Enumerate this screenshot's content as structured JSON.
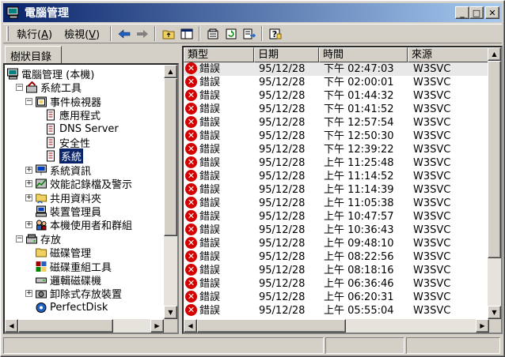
{
  "window": {
    "title": "電腦管理",
    "buttons": {
      "minimize": "_",
      "maximize": "□",
      "close": "✕"
    }
  },
  "menu": [
    {
      "label": "執行(",
      "accel": "A",
      "suffix": ")"
    },
    {
      "label": "檢視(",
      "accel": "V",
      "suffix": ")"
    }
  ],
  "toolbar_icons": [
    "back-arrow-icon",
    "forward-arrow-icon",
    "up-folder-icon",
    "show-hide-tree-icon",
    "properties-icon",
    "refresh-icon",
    "export-list-icon",
    "help-icon"
  ],
  "left_tab": "樹狀目錄",
  "tree": [
    {
      "label": "電腦管理 (本機)",
      "indent": 0,
      "expander": "",
      "icon": "computer-management-icon",
      "name": "tree-computer-management"
    },
    {
      "label": "系統工具",
      "indent": 1,
      "expander": "−",
      "icon": "system-tools-icon",
      "name": "tree-system-tools"
    },
    {
      "label": "事件檢視器",
      "indent": 2,
      "expander": "−",
      "icon": "event-viewer-icon",
      "name": "tree-event-viewer"
    },
    {
      "label": "應用程式",
      "indent": 3,
      "expander": "",
      "icon": "log-icon",
      "name": "tree-application-log"
    },
    {
      "label": "DNS Server",
      "indent": 3,
      "expander": "",
      "icon": "log-icon",
      "name": "tree-dns-server-log"
    },
    {
      "label": "安全性",
      "indent": 3,
      "expander": "",
      "icon": "log-icon",
      "name": "tree-security-log"
    },
    {
      "label": "系統",
      "indent": 3,
      "expander": "",
      "icon": "log-icon",
      "name": "tree-system-log",
      "selected": true
    },
    {
      "label": "系統資訊",
      "indent": 2,
      "expander": "+",
      "icon": "system-info-icon",
      "name": "tree-system-info"
    },
    {
      "label": "效能記錄檔及警示",
      "indent": 2,
      "expander": "+",
      "icon": "performance-icon",
      "name": "tree-performance-logs"
    },
    {
      "label": "共用資料夾",
      "indent": 2,
      "expander": "+",
      "icon": "shared-folder-icon",
      "name": "tree-shared-folders"
    },
    {
      "label": "裝置管理員",
      "indent": 2,
      "expander": "",
      "icon": "device-manager-icon",
      "name": "tree-device-manager"
    },
    {
      "label": "本機使用者和群組",
      "indent": 2,
      "expander": "+",
      "icon": "users-groups-icon",
      "name": "tree-local-users"
    },
    {
      "label": "存放",
      "indent": 1,
      "expander": "−",
      "icon": "storage-icon",
      "name": "tree-storage"
    },
    {
      "label": "磁碟管理",
      "indent": 2,
      "expander": "",
      "icon": "folder-icon",
      "name": "tree-disk-management"
    },
    {
      "label": "磁碟重組工具",
      "indent": 2,
      "expander": "",
      "icon": "defrag-icon",
      "name": "tree-defragmenter"
    },
    {
      "label": "邏輯磁碟機",
      "indent": 2,
      "expander": "",
      "icon": "drive-icon",
      "name": "tree-logical-drives"
    },
    {
      "label": "卸除式存放裝置",
      "indent": 2,
      "expander": "+",
      "icon": "removable-storage-icon",
      "name": "tree-removable-storage"
    },
    {
      "label": "PerfectDisk",
      "indent": 2,
      "expander": "",
      "icon": "perfectdisk-icon",
      "name": "tree-perfectdisk"
    }
  ],
  "list": {
    "columns": [
      "類型",
      "日期",
      "時間",
      "來源"
    ],
    "rows": [
      {
        "type": "錯誤",
        "date": "95/12/28",
        "time": "下午 02:47:03",
        "source": "W3SVC"
      },
      {
        "type": "錯誤",
        "date": "95/12/28",
        "time": "下午 02:00:01",
        "source": "W3SVC"
      },
      {
        "type": "錯誤",
        "date": "95/12/28",
        "time": "下午 01:44:32",
        "source": "W3SVC"
      },
      {
        "type": "錯誤",
        "date": "95/12/28",
        "time": "下午 01:41:52",
        "source": "W3SVC"
      },
      {
        "type": "錯誤",
        "date": "95/12/28",
        "time": "下午 12:57:54",
        "source": "W3SVC"
      },
      {
        "type": "錯誤",
        "date": "95/12/28",
        "time": "下午 12:50:30",
        "source": "W3SVC"
      },
      {
        "type": "錯誤",
        "date": "95/12/28",
        "time": "下午 12:39:22",
        "source": "W3SVC"
      },
      {
        "type": "錯誤",
        "date": "95/12/28",
        "time": "上午 11:25:48",
        "source": "W3SVC"
      },
      {
        "type": "錯誤",
        "date": "95/12/28",
        "time": "上午 11:14:52",
        "source": "W3SVC"
      },
      {
        "type": "錯誤",
        "date": "95/12/28",
        "time": "上午 11:14:39",
        "source": "W3SVC"
      },
      {
        "type": "錯誤",
        "date": "95/12/28",
        "time": "上午 11:05:38",
        "source": "W3SVC"
      },
      {
        "type": "錯誤",
        "date": "95/12/28",
        "time": "上午 10:47:57",
        "source": "W3SVC"
      },
      {
        "type": "錯誤",
        "date": "95/12/28",
        "time": "上午 10:36:43",
        "source": "W3SVC"
      },
      {
        "type": "錯誤",
        "date": "95/12/28",
        "time": "上午 09:48:10",
        "source": "W3SVC"
      },
      {
        "type": "錯誤",
        "date": "95/12/28",
        "time": "上午 08:22:56",
        "source": "W3SVC"
      },
      {
        "type": "錯誤",
        "date": "95/12/28",
        "time": "上午 08:18:16",
        "source": "W3SVC"
      },
      {
        "type": "錯誤",
        "date": "95/12/28",
        "time": "上午 06:36:46",
        "source": "W3SVC"
      },
      {
        "type": "錯誤",
        "date": "95/12/28",
        "time": "上午 06:20:31",
        "source": "W3SVC"
      },
      {
        "type": "錯誤",
        "date": "95/12/28",
        "time": "上午 05:55:04",
        "source": "W3SVC"
      }
    ]
  },
  "colors": {
    "title_start": "#0a246a",
    "title_end": "#a6caf0",
    "error": "#d40000",
    "selection": "#0a246a"
  }
}
